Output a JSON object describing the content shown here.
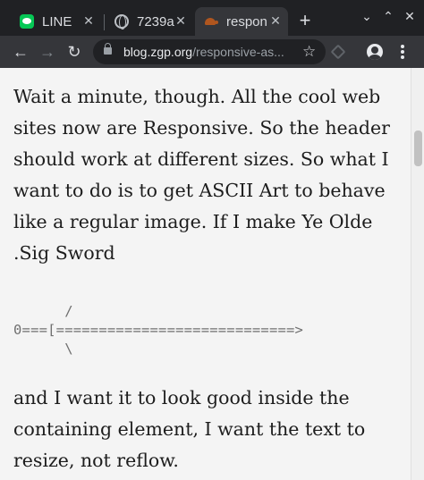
{
  "tabs": [
    {
      "title": "LINE",
      "icon": "line-app-icon",
      "active": false
    },
    {
      "title": "7239a",
      "icon": "globe-icon",
      "active": false
    },
    {
      "title": "respon",
      "icon": "turtle-icon",
      "active": true
    }
  ],
  "tab_close_glyph": "✕",
  "new_tab_glyph": "+",
  "window_controls": {
    "minimize": "⌄",
    "maximize": "⌃"
  },
  "toolbar": {
    "back": "←",
    "forward": "→",
    "reload": "↻",
    "url_host": "blog.zgp.org",
    "url_path": "/responsive-as...",
    "bookmark": "☆"
  },
  "article": {
    "paragraph1": "Wait a minute, though. All the cool web sites now are Responsive. So the header should work at different sizes. So what I want to do is to get ASCII Art to behave like a regular image. If I make Ye Olde .Sig Sword",
    "ascii_art": "      /\n0===[============================>\n      \\",
    "paragraph2": "and I want it to look good inside the containing element, I want the text to resize, not reflow."
  },
  "colors": {
    "tabstrip_bg": "#202124",
    "toolbar_bg": "#35363a",
    "page_bg": "#f4f4f4",
    "text": "#1d1d1d",
    "ascii_text": "#707070"
  }
}
